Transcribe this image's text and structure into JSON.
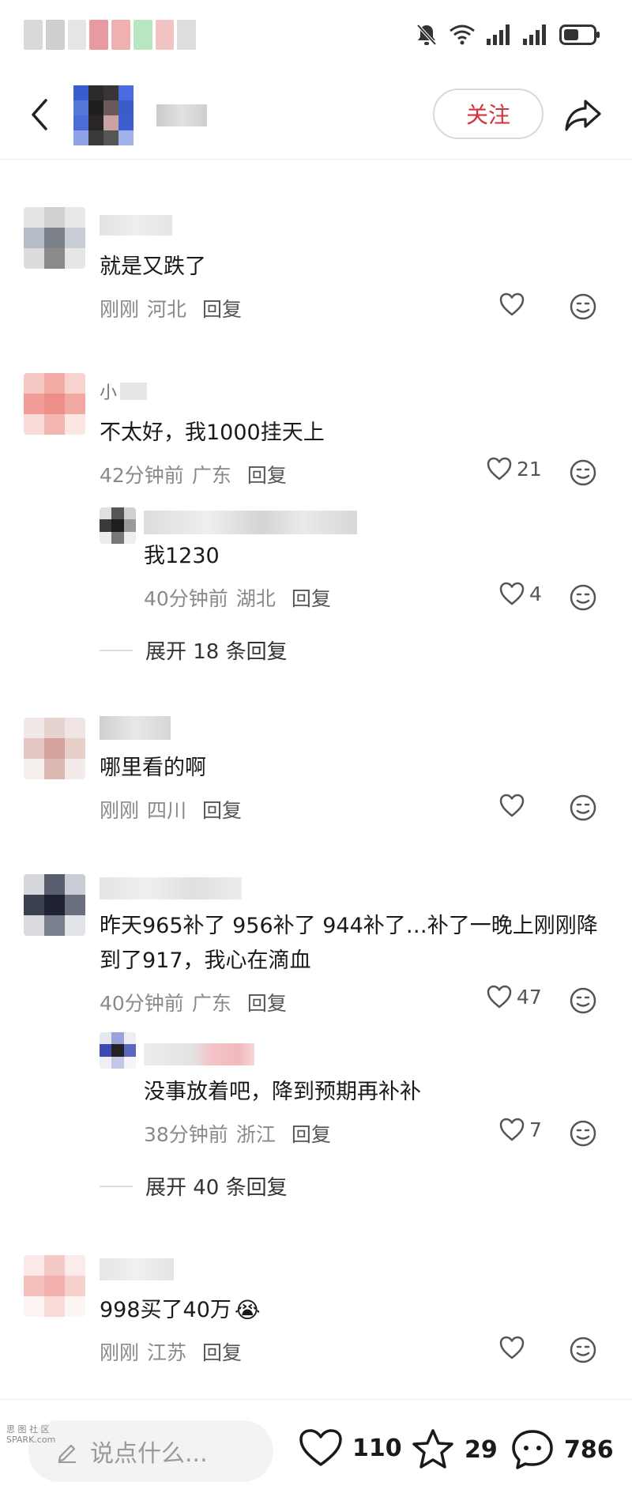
{
  "header": {
    "follow_label": "关注"
  },
  "comments": [
    {
      "text": "就是又跌了",
      "time": "刚刚",
      "location": "河北",
      "reply_label": "回复",
      "likes": ""
    },
    {
      "text": "不太好，我1000挂天上",
      "time": "42分钟前",
      "location": "广东",
      "reply_label": "回复",
      "likes": "21",
      "name_visible": "小",
      "sub_reply": {
        "text": "我1230",
        "time": "40分钟前",
        "location": "湖北",
        "reply_label": "回复",
        "likes": "4"
      },
      "expand_label": "展开 18 条回复"
    },
    {
      "text": "哪里看的啊",
      "time": "刚刚",
      "location": "四川",
      "reply_label": "回复",
      "likes": ""
    },
    {
      "text": "昨天965补了 956补了 944补了…补了一晚上刚刚降到了917，我心在滴血",
      "time": "40分钟前",
      "location": "广东",
      "reply_label": "回复",
      "likes": "47",
      "sub_reply": {
        "text": "没事放着吧，降到预期再补补",
        "time": "38分钟前",
        "location": "浙江",
        "reply_label": "回复",
        "likes": "7"
      },
      "expand_label": "展开 40 条回复"
    },
    {
      "text": "998买了40万",
      "emoji": "😭",
      "time": "刚刚",
      "location": "江苏",
      "reply_label": "回复",
      "likes": ""
    }
  ],
  "bottom_bar": {
    "input_placeholder": "说点什么...",
    "like_count": "110",
    "favorite_count": "29",
    "comment_count": "786"
  },
  "watermark": {
    "line1": "思 图 社 区",
    "line2": "SPARK.com"
  },
  "icons": {
    "back": "chevron-left-icon",
    "share": "share-icon",
    "like": "heart-outline-icon",
    "react": "smiley-face-icon",
    "favorite": "star-outline-icon",
    "comment": "chat-bubble-icon"
  },
  "colors": {
    "accent": "#d4323c",
    "muted": "#8a8a8a",
    "text": "#1a1a1a"
  }
}
